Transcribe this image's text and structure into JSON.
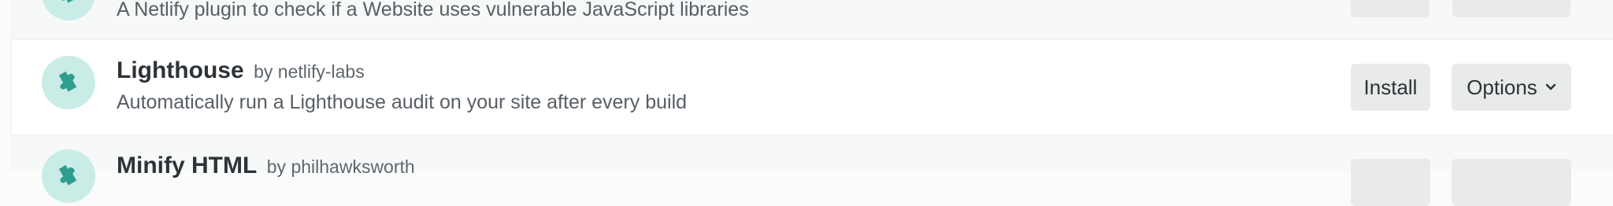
{
  "plugins": [
    {
      "name": "",
      "author": "",
      "description": "A Netlify plugin to check if a Website uses vulnerable JavaScript libraries",
      "install_label": "",
      "options_label": ""
    },
    {
      "name": "Lighthouse",
      "author": "by netlify-labs",
      "description": "Automatically run a Lighthouse audit on your site after every build",
      "install_label": "Install",
      "options_label": "Options"
    },
    {
      "name": "Minify HTML",
      "author": "by philhawksworth",
      "description": "",
      "install_label": "",
      "options_label": ""
    }
  ],
  "icons": {
    "plugin": "puzzle-piece-icon",
    "options_caret": "chevron-down-icon"
  },
  "colors": {
    "icon_bg": "#c9ece6",
    "icon_fg": "#2f9e8e",
    "button_bg": "#e9ebeb",
    "row_bg": "#ffffff",
    "faded_row_bg": "#f7f8f8"
  }
}
